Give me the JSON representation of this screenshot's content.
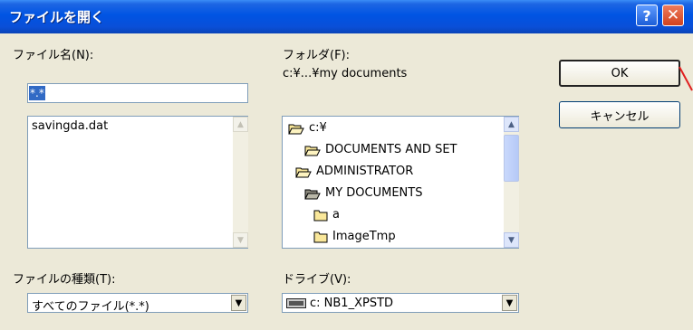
{
  "window": {
    "title": "ファイルを開く",
    "help_label": "?",
    "close_label": "✕"
  },
  "filename": {
    "label": "ファイル名(N):",
    "value": "*.*",
    "files": [
      "savingda.dat"
    ]
  },
  "folder": {
    "label": "フォルダ(F):",
    "current_path": "c:¥...¥my documents",
    "tree": [
      {
        "name": "c:¥",
        "icon": "open-folder-icon"
      },
      {
        "name": "DOCUMENTS AND SET",
        "icon": "open-folder-icon"
      },
      {
        "name": "ADMINISTRATOR",
        "icon": "open-folder-icon"
      },
      {
        "name": "MY DOCUMENTS",
        "icon": "open-folder-dark-icon"
      },
      {
        "name": "a",
        "icon": "folder-icon"
      },
      {
        "name": "ImageTmp",
        "icon": "folder-icon"
      }
    ]
  },
  "filetype": {
    "label": "ファイルの種類(T):",
    "selected": "すべてのファイル(*.*)"
  },
  "drive": {
    "label": "ドライブ(V):",
    "selected": "c: NB1_XPSTD",
    "icon": "drive-icon"
  },
  "buttons": {
    "ok": "OK",
    "cancel": "キャンセル"
  },
  "colors": {
    "titlebar": "#0054e3",
    "selection": "#316ac5",
    "dialog_bg": "#ece9d8",
    "annotation_red": "#e02020"
  }
}
